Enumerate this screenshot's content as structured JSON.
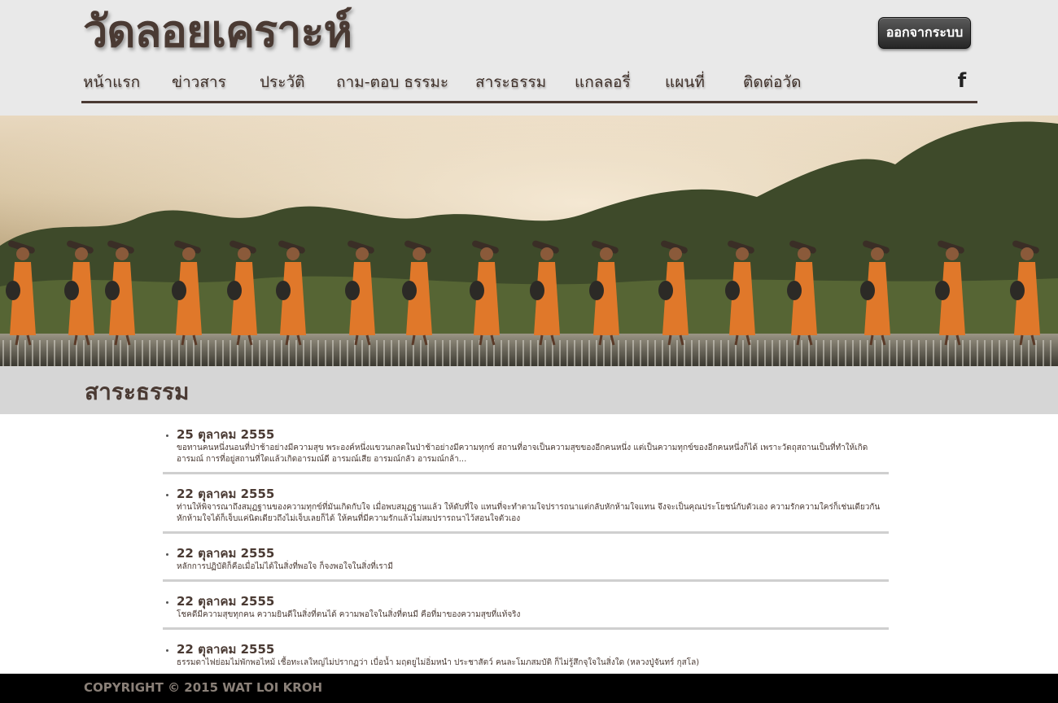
{
  "header": {
    "site_title": "วัดลอยเคราะห์",
    "logout_label": "ออกจากระบบ",
    "nav": [
      {
        "label": "หน้าแรก"
      },
      {
        "label": "ข่าวสาร"
      },
      {
        "label": "ประวัติ"
      },
      {
        "label": "ถาม-ตอบ ธรรมะ"
      },
      {
        "label": "สาระธรรม"
      },
      {
        "label": "แกลลอรี่"
      },
      {
        "label": "แผนที่"
      },
      {
        "label": "ติดต่อวัด"
      }
    ],
    "social_icon": "facebook-icon",
    "social_glyph": "f"
  },
  "banner": {
    "image": "row-of-monks-in-orange-robes-walking-on-weir-forest-background"
  },
  "section": {
    "title": "สาระธรรม"
  },
  "articles": [
    {
      "date": "25 ตุลาคม 2555",
      "excerpt": "ขอทานคนหนึ่งนอนที่ป่าช้าอย่างมีความสุข พระองค์หนึ่งแขวนกลดในป่าช้าอย่างมีความทุกข์ สถานที่อาจเป็นความสุขของอีกคนหนึ่ง แต่เป็นความทุกข์ของอีกคนหนึ่งก็ได้ เพราะวัตถุสถานเป็นที่ทำให้เกิดอารมณ์ การที่อยู่สถานที่ใดแล้วเกิดอารมณ์ดี อารมณ์เสีย อารมณ์กลัว อารมณ์กล้า..."
    },
    {
      "date": "22 ตุลาคม 2555",
      "excerpt": "ท่านให้พิจารณาถึงสมุฏฐานของความทุกข์ที่มันเกิดกับใจ เมื่อพบสมุฏฐานแล้ว ให้ดับที่ใจ แทนที่จะทำตามใจปรารถนาแต่กลับหักห้ามใจแทน จึงจะเป็นคุณประโยชน์กับตัวเอง ความรักความใคร่ก็เช่นเดียวกัน หักห้ามใจได้ก็เจ็บแค่นิดเดียวถึงไม่เจ็บเลยก็ได้ ให้คนที่มีความรักแล้วไม่สมปรารถนาไว้สอนใจตัวเอง"
    },
    {
      "date": "22 ตุลาคม 2555",
      "excerpt": "หลักการปฏิบัติก็คือเมื่อไม่ได้ในสิ่งที่พอใจ ก็จงพอใจในสิ่งที่เรามี"
    },
    {
      "date": "22 ตุลาคม 2555",
      "excerpt": "โชคดีมีความสุขทุกคน ความยินดีในสิ่งที่ตนได้ ความพอใจในสิ่งที่ตนมี คือที่มาของความสุขที่แท้จริง"
    },
    {
      "date": "22 ตุลาคม 2555",
      "excerpt": "ธรรมดาไฟย่อมไม่พักพอไหม้ เชื้อทะเลใหญ่ไม่ปรากฏว่า เบื่อน้ำ มฤตยูไม่อิ่มหนำ ประชาสัตว์ คนละโมภสมบัติ ก็ไม่รู้สึกจุใจในสิ่งใด (หลวงปู่จันทร์ กุสโล)"
    }
  ],
  "footer": {
    "copyright": "COPYRIGHT © 2015 WAT LOI KROH"
  },
  "colors": {
    "header_bg": "#e9e9e9",
    "text_brown": "#4a3a33",
    "section_bar": "#d6d6d6",
    "footer_bg": "#000000",
    "robe_orange": "#e0782a"
  }
}
